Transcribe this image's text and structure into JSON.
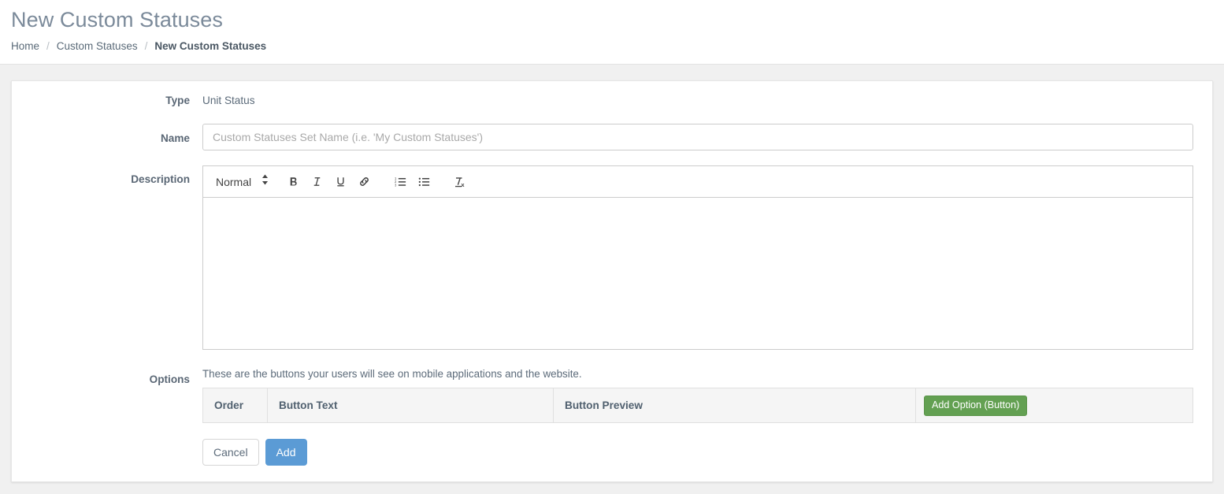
{
  "header": {
    "title": "New Custom Statuses",
    "breadcrumb": [
      {
        "label": "Home",
        "current": false
      },
      {
        "label": "Custom Statuses",
        "current": false
      },
      {
        "label": "New Custom Statuses",
        "current": true
      }
    ],
    "separator": "/"
  },
  "form": {
    "type": {
      "label": "Type",
      "value": "Unit Status"
    },
    "name": {
      "label": "Name",
      "value": "",
      "placeholder": "Custom Statuses Set Name (i.e. 'My Custom Statuses')"
    },
    "description": {
      "label": "Description",
      "value": "",
      "toolbar": {
        "format_picker": {
          "name": "format-picker",
          "value": "Normal"
        },
        "buttons": [
          {
            "name": "bold-icon",
            "label": "B"
          },
          {
            "name": "italic-icon",
            "label": "I"
          },
          {
            "name": "underline-icon",
            "label": "U"
          },
          {
            "name": "link-icon",
            "label": "Link"
          },
          {
            "name": "ordered-list-icon",
            "label": "Ordered List"
          },
          {
            "name": "bullet-list-icon",
            "label": "Bullet List"
          },
          {
            "name": "clear-format-icon",
            "label": "Tx"
          }
        ]
      }
    },
    "options": {
      "label": "Options",
      "help_text": "These are the buttons your users will see on mobile applications and the website.",
      "columns": [
        "Order",
        "Button Text",
        "Button Preview"
      ],
      "rows": [],
      "add_button_label": "Add Option (Button)"
    }
  },
  "actions": {
    "cancel_label": "Cancel",
    "submit_label": "Add"
  },
  "colors": {
    "primary": "#5b9bd5",
    "success": "#63a052",
    "page_background": "#f0f0f0",
    "title_text": "#7b8a9a",
    "label_text": "#5a6775"
  }
}
